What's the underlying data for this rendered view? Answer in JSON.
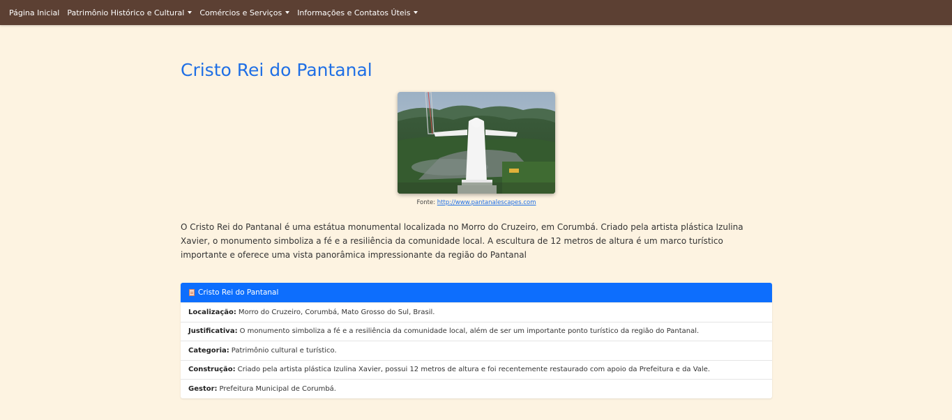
{
  "nav": {
    "items": [
      {
        "label": "Página Inicial",
        "dropdown": false
      },
      {
        "label": "Patrimônio Histórico e Cultural",
        "dropdown": true
      },
      {
        "label": "Comércios e Serviços",
        "dropdown": true
      },
      {
        "label": "Informações e Contatos Úteis",
        "dropdown": true
      }
    ]
  },
  "page": {
    "title": "Cristo Rei do Pantanal",
    "caption_prefix": "Fonte:",
    "caption_link": "http://www.pantanalescapes.com",
    "description": "O Cristo Rei do Pantanal é uma estátua monumental localizada no Morro do Cruzeiro, em Corumbá. Criado pela artista plástica Izulina Xavier, o monumento simboliza a fé e a resiliência da comunidade local. A escultura de 12 metros de altura é um marco turístico importante e oferece uma vista panorâmica impressionante da região do Pantanal"
  },
  "card": {
    "header": "Cristo Rei do Pantanal",
    "rows": [
      {
        "label": "Localização:",
        "value": "Morro do Cruzeiro, Corumbá, Mato Grosso do Sul, Brasil."
      },
      {
        "label": "Justificativa:",
        "value": "O monumento simboliza a fé e a resiliência da comunidade local, além de ser um importante ponto turístico da região do Pantanal."
      },
      {
        "label": "Categoria:",
        "value": "Patrimônio cultural e turístico."
      },
      {
        "label": "Construção:",
        "value": "Criado pela artista plástica Izulina Xavier, possui 12 metros de altura e foi recentemente restaurado com apoio da Prefeitura e da Vale."
      },
      {
        "label": "Gestor:",
        "value": "Prefeitura Municipal de Corumbá."
      }
    ]
  },
  "colors": {
    "navbar": "#5c4033",
    "background": "#fdf3e1",
    "accent": "#0d6efd",
    "title": "#1f6fe5"
  },
  "icons": {
    "card_header": "document-icon"
  }
}
